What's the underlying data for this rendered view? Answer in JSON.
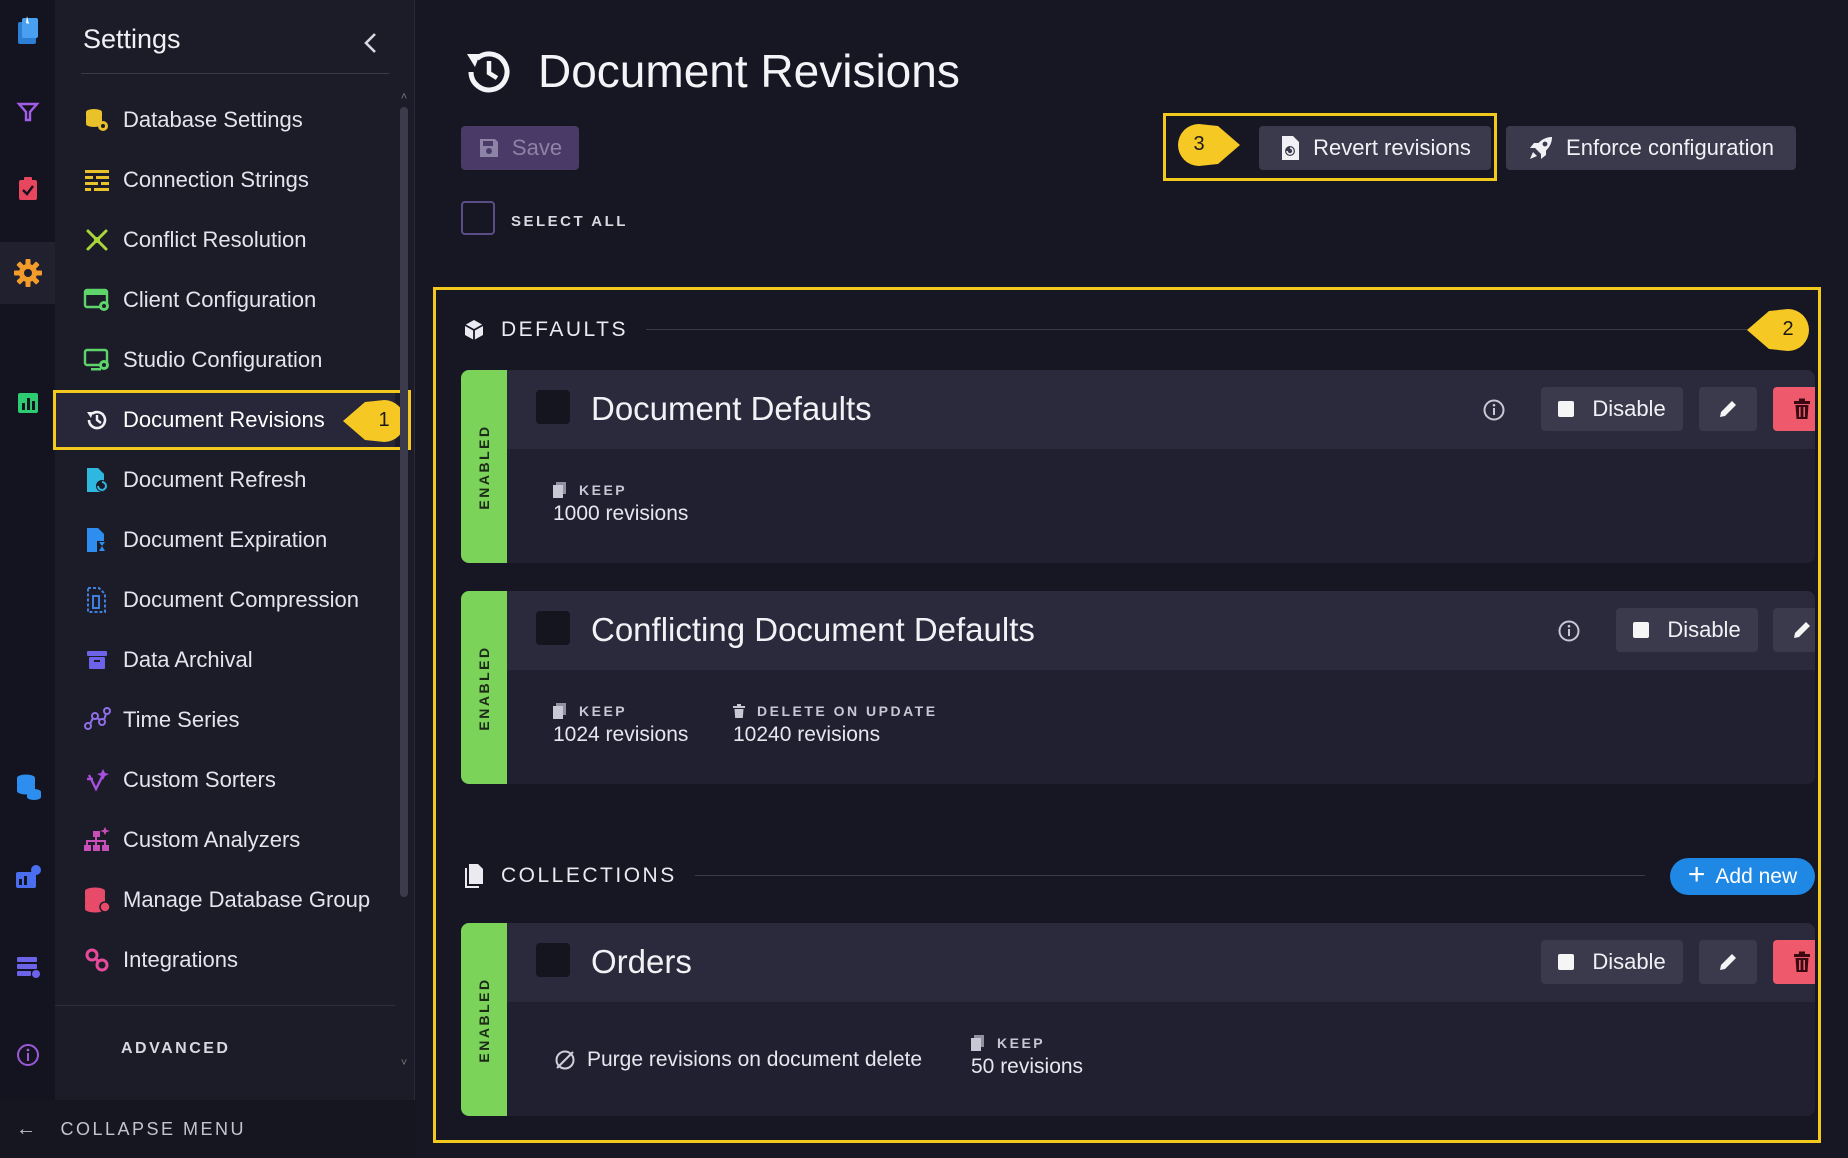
{
  "menu": {
    "title": "Settings",
    "items": [
      {
        "label": "Database Settings",
        "icon": "database-settings-icon"
      },
      {
        "label": "Connection Strings",
        "icon": "connection-strings-icon"
      },
      {
        "label": "Conflict Resolution",
        "icon": "conflict-resolution-icon"
      },
      {
        "label": "Client Configuration",
        "icon": "client-configuration-icon"
      },
      {
        "label": "Studio Configuration",
        "icon": "studio-configuration-icon"
      },
      {
        "label": "Document Revisions",
        "icon": "document-revisions-icon",
        "active": true
      },
      {
        "label": "Document Refresh",
        "icon": "document-refresh-icon"
      },
      {
        "label": "Document Expiration",
        "icon": "document-expiration-icon"
      },
      {
        "label": "Document Compression",
        "icon": "document-compression-icon"
      },
      {
        "label": "Data Archival",
        "icon": "data-archival-icon"
      },
      {
        "label": "Time Series",
        "icon": "time-series-icon"
      },
      {
        "label": "Custom Sorters",
        "icon": "custom-sorters-icon"
      },
      {
        "label": "Custom Analyzers",
        "icon": "custom-analyzers-icon"
      },
      {
        "label": "Manage Database Group",
        "icon": "manage-database-group-icon"
      },
      {
        "label": "Integrations",
        "icon": "integrations-icon"
      }
    ],
    "advanced_label": "ADVANCED",
    "collapse_label": "COLLAPSE MENU"
  },
  "callouts": {
    "one": "1",
    "two": "2",
    "three": "3"
  },
  "page": {
    "title": "Document Revisions",
    "save_label": "Save",
    "revert_label": "Revert revisions",
    "enforce_label": "Enforce configuration",
    "select_all_label": "SELECT ALL"
  },
  "defaults": {
    "section_label": "DEFAULTS",
    "cards": [
      {
        "status": "ENABLED",
        "name": "Document Defaults",
        "disable_label": "Disable",
        "keep_label": "KEEP",
        "keep_value": "1000 revisions"
      },
      {
        "status": "ENABLED",
        "name": "Conflicting Document Defaults",
        "disable_label": "Disable",
        "keep_label": "KEEP",
        "keep_value": "1024 revisions",
        "delete_label": "DELETE ON UPDATE",
        "delete_value": "10240 revisions"
      }
    ]
  },
  "collections": {
    "section_label": "COLLECTIONS",
    "add_new_label": "Add new",
    "cards": [
      {
        "status": "ENABLED",
        "name": "Orders",
        "disable_label": "Disable",
        "purge_label": "Purge revisions on document delete",
        "keep_label": "KEEP",
        "keep_value": "50 revisions"
      }
    ]
  },
  "colors": {
    "accent_yellow": "#f4c91d",
    "enabled_green": "#7bd35a",
    "delete_red": "#ee5a6c",
    "add_blue": "#1f88e5",
    "gear_orange": "#f39c2b"
  }
}
